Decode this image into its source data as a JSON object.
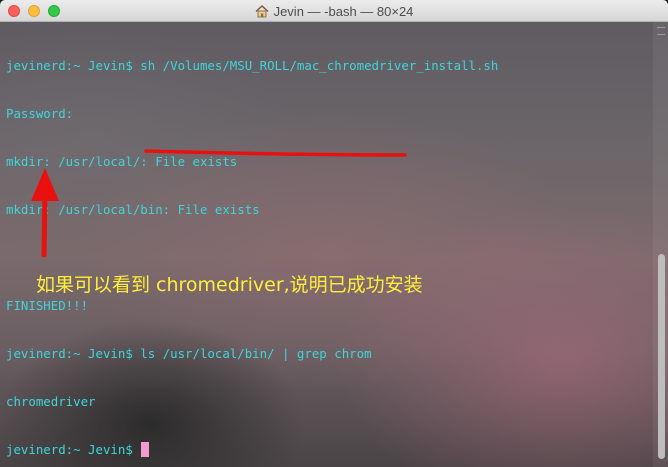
{
  "window": {
    "title": "Jevin — -bash — 80×24",
    "title_icon": "home-icon"
  },
  "terminal": {
    "lines": [
      "jevinerd:~ Jevin$ sh /Volumes/MSU_ROLL/mac_chromedriver_install.sh",
      "Password:",
      "mkdir: /usr/local/: File exists",
      "mkdir: /usr/local/bin: File exists",
      "",
      "FINISHED!!!",
      "jevinerd:~ Jevin$ ls /usr/local/bin/ | grep chrom",
      "chromedriver"
    ],
    "prompt": "jevinerd:~ Jevin$ ",
    "text_color": "#3cd7dc",
    "cursor_color": "#f29ad2"
  },
  "annotation": {
    "text": "如果可以看到 chromedriver,说明已成功安装",
    "color": "#ffef3a",
    "mark_color": "#e8110f"
  }
}
